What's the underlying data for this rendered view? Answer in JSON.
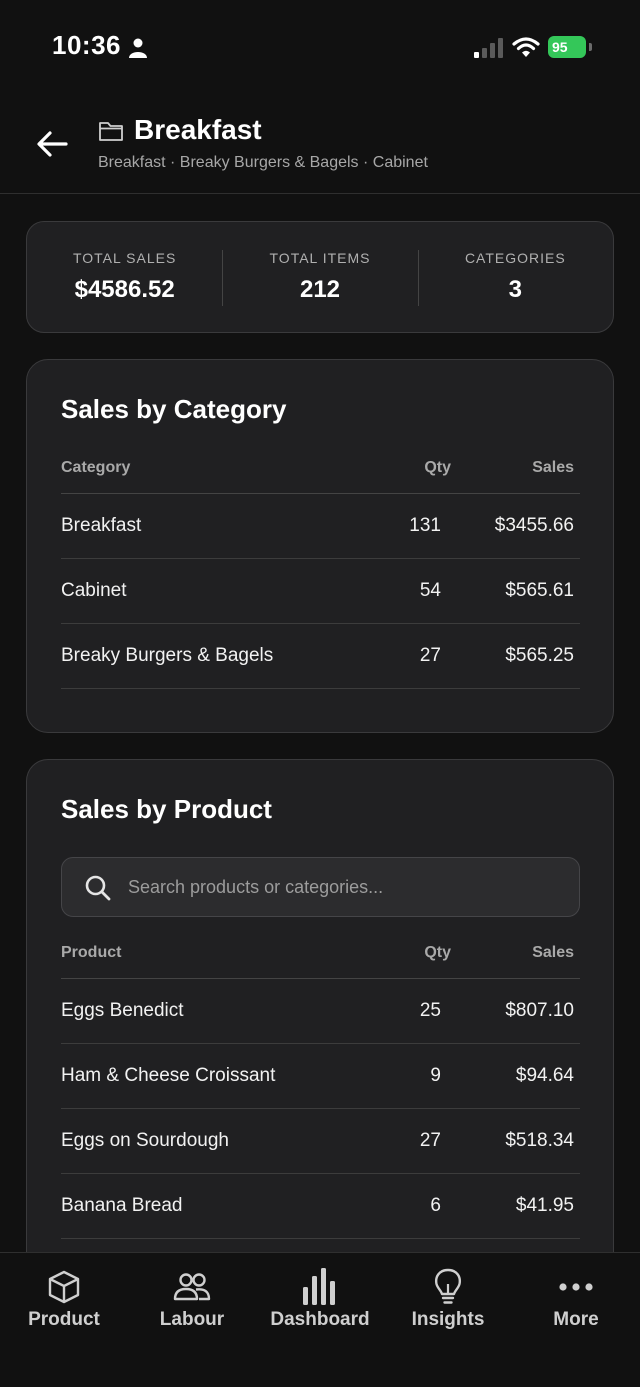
{
  "status_bar": {
    "time": "10:36",
    "battery": "95"
  },
  "header": {
    "title": "Breakfast",
    "breadcrumb": "Breakfast · Breaky Burgers & Bagels · Cabinet"
  },
  "summary": [
    {
      "label": "TOTAL SALES",
      "value": "$4586.52"
    },
    {
      "label": "TOTAL ITEMS",
      "value": "212"
    },
    {
      "label": "CATEGORIES",
      "value": "3"
    }
  ],
  "category_card": {
    "title": "Sales by Category",
    "columns": [
      "Category",
      "Qty",
      "Sales"
    ],
    "rows": [
      {
        "name": "Breakfast",
        "qty": "131",
        "sales": "$3455.66"
      },
      {
        "name": "Cabinet",
        "qty": "54",
        "sales": "$565.61"
      },
      {
        "name": "Breaky Burgers & Bagels",
        "qty": "27",
        "sales": "$565.25"
      }
    ]
  },
  "product_card": {
    "title": "Sales by Product",
    "search_placeholder": "Search products or categories...",
    "columns": [
      "Product",
      "Qty",
      "Sales"
    ],
    "rows": [
      {
        "name": "Eggs Benedict",
        "qty": "25",
        "sales": "$807.10"
      },
      {
        "name": "Ham & Cheese Croissant",
        "qty": "9",
        "sales": "$94.64"
      },
      {
        "name": "Eggs on Sourdough",
        "qty": "27",
        "sales": "$518.34"
      },
      {
        "name": "Banana Bread",
        "qty": "6",
        "sales": "$41.95"
      }
    ]
  },
  "nav": [
    {
      "label": "Product",
      "icon": "cube-icon"
    },
    {
      "label": "Labour",
      "icon": "people-icon"
    },
    {
      "label": "Dashboard",
      "icon": "bar-chart-icon"
    },
    {
      "label": "Insights",
      "icon": "lightbulb-icon"
    },
    {
      "label": "More",
      "icon": "more-dots-icon"
    }
  ],
  "colors": {
    "background": "#111111",
    "card": "#202022",
    "battery": "#34c759"
  }
}
